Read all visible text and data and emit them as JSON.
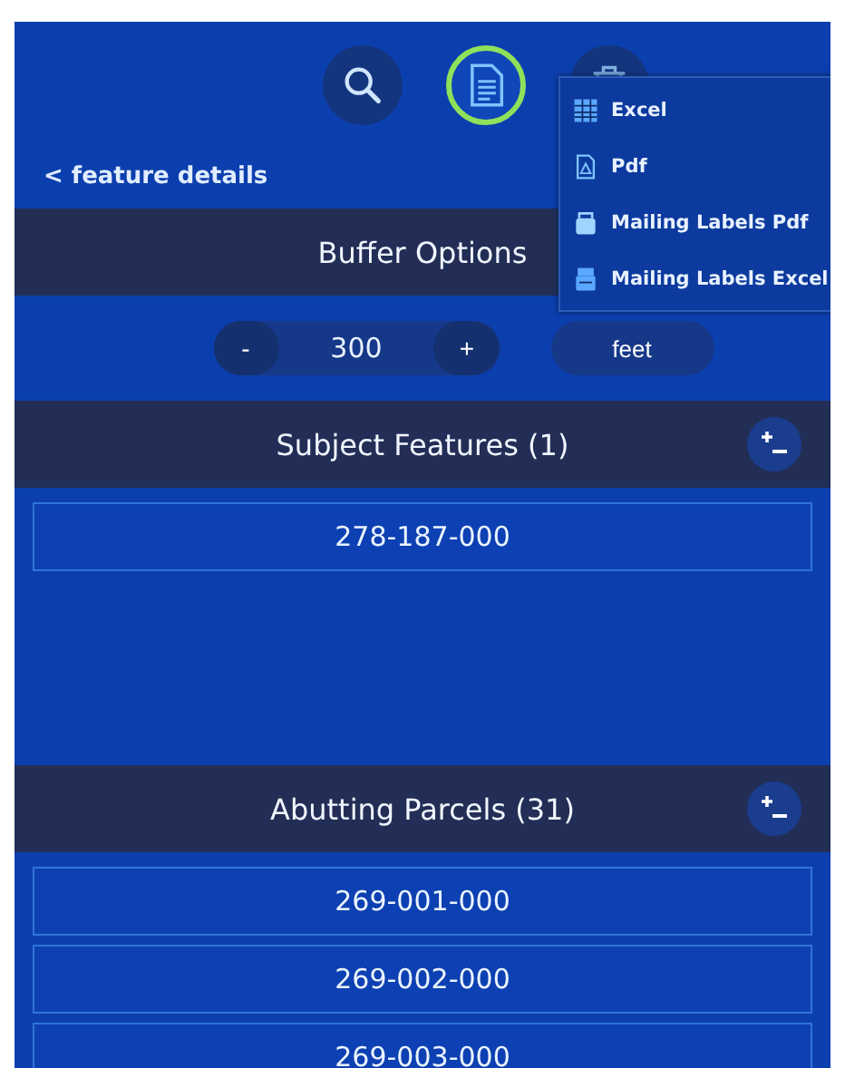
{
  "toolbar": [
    {
      "kind": "search",
      "selected": false
    },
    {
      "kind": "document",
      "selected": true
    },
    {
      "kind": "trash",
      "selected": false
    }
  ],
  "back_link": "< feature details",
  "export_menu": [
    {
      "kind": "excel",
      "label": "Excel"
    },
    {
      "kind": "pdf",
      "label": "Pdf"
    },
    {
      "kind": "labels-pdf",
      "label": "Mailing Labels Pdf"
    },
    {
      "kind": "labels-excel",
      "label": "Mailing Labels Excel"
    }
  ],
  "buffer": {
    "title": "Buffer Options",
    "decrement": "-",
    "value": "300",
    "increment": "+",
    "unit": "feet"
  },
  "sections": [
    {
      "title": "Subject Features (1)",
      "rows": [
        "278-187-000"
      ]
    },
    {
      "title": "Abutting Parcels (31)",
      "rows": [
        "269-001-000",
        "269-002-000",
        "269-003-000"
      ]
    }
  ]
}
